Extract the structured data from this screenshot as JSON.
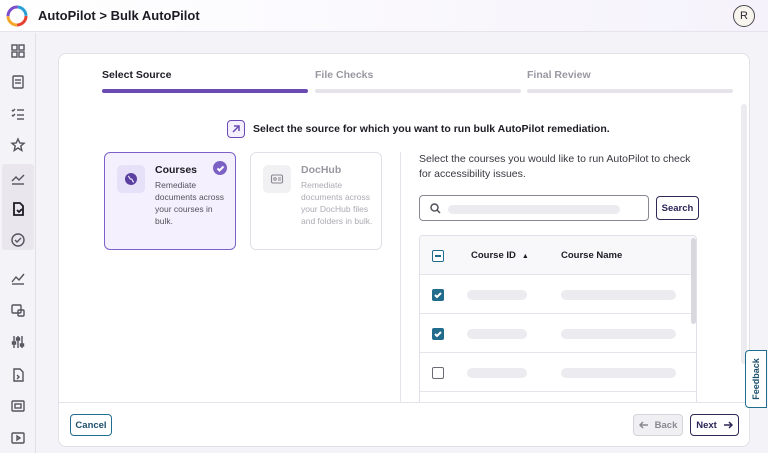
{
  "header": {
    "title": "AutoPilot > Bulk AutoPilot",
    "avatar_initial": "R"
  },
  "sidebar": {
    "icons": [
      "dashboard-icon",
      "document-icon",
      "checklist-icon",
      "star-icon",
      "courses-icon",
      "autopilot-file-icon",
      "circle-check-icon",
      "analytics-icon",
      "reports-icon",
      "settings-sliders-icon",
      "file-export-icon",
      "media-icon",
      "video-icon"
    ],
    "active": "autopilot-file-icon"
  },
  "steps": [
    {
      "label": "Select Source",
      "active": true
    },
    {
      "label": "File Checks",
      "active": false
    },
    {
      "label": "Final Review",
      "active": false
    }
  ],
  "prompt": "Select the source for which you want to run bulk AutoPilot remediation.",
  "sources": [
    {
      "title": "Courses",
      "description": "Remediate documents across your courses in bulk.",
      "selected": true,
      "icon": "globe-icon"
    },
    {
      "title": "DocHub",
      "description": "Remediate documents across your DocHub files and folders in bulk.",
      "selected": false,
      "icon": "id-card-icon"
    }
  ],
  "courses_panel": {
    "description": "Select the courses you would like to run AutoPilot to check for accessibility issues.",
    "search_button": "Search",
    "columns": {
      "course_id": "Course ID",
      "course_name": "Course Name"
    },
    "sort_indicator": "▲",
    "rows": [
      {
        "checked": true
      },
      {
        "checked": true
      },
      {
        "checked": false
      }
    ]
  },
  "footer": {
    "cancel": "Cancel",
    "back": "Back",
    "next": "Next"
  },
  "feedback_label": "Feedback",
  "colors": {
    "accent": "#6a4bb4",
    "teal": "#216b8c",
    "navy": "#2a2558"
  }
}
